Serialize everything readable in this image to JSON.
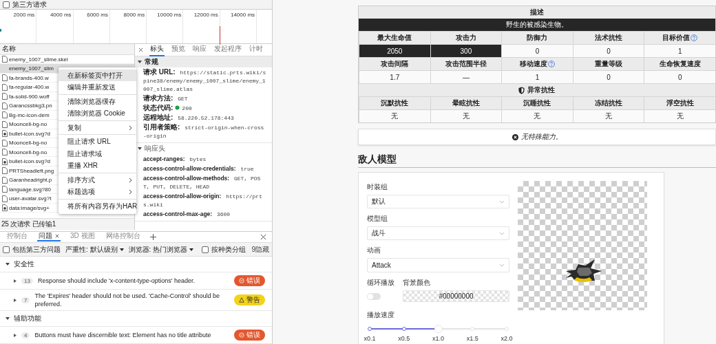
{
  "filter": {
    "label": "第三方请求",
    "checked": false
  },
  "timeline": {
    "ticks": [
      "2000 ms",
      "4000 ms",
      "6000 ms",
      "8000 ms",
      "10000 ms",
      "12000 ms",
      "14000 ms"
    ]
  },
  "requests": {
    "column": "名称",
    "items": [
      {
        "name": "enemy_1007_slime.skel",
        "kind": "document",
        "selected": false
      },
      {
        "name": "enemy_1007_slim",
        "kind": "blank",
        "selected": true
      },
      {
        "name": "fa-brands-400.w",
        "kind": "document",
        "selected": false
      },
      {
        "name": "fa-regular-400.w",
        "kind": "document",
        "selected": false
      },
      {
        "name": "fa-solid-900.woff",
        "kind": "document",
        "selected": false
      },
      {
        "name": "Garancssbkg3.pn",
        "kind": "document",
        "selected": false
      },
      {
        "name": "Bg-mc-icon-dem",
        "kind": "document",
        "selected": false
      },
      {
        "name": "Mooncell-bg-no",
        "kind": "document",
        "selected": false
      },
      {
        "name": "bullet-icon.svg?d",
        "kind": "image",
        "selected": false
      },
      {
        "name": "Mooncell-bg-no",
        "kind": "document",
        "selected": false
      },
      {
        "name": "Mooncell-bg-no",
        "kind": "document",
        "selected": false
      },
      {
        "name": "bullet-icon.svg?d",
        "kind": "image",
        "selected": false
      },
      {
        "name": "PRTSheadleft.png",
        "kind": "document",
        "selected": false
      },
      {
        "name": "Garanheadright.p",
        "kind": "document",
        "selected": false
      },
      {
        "name": "language.svg?80",
        "kind": "document",
        "selected": false
      },
      {
        "name": "user-avatar.svg?t",
        "kind": "document",
        "selected": false
      },
      {
        "name": "data:image/svg+",
        "kind": "image",
        "selected": false
      }
    ],
    "status": "25 次请求 已传输1"
  },
  "context_menu": [
    {
      "kind": "item",
      "label": "在新标签页中打开",
      "highlighted": true,
      "submenu": false
    },
    {
      "kind": "item",
      "label": "编辑并重新发送",
      "highlighted": false,
      "submenu": false
    },
    {
      "kind": "separator"
    },
    {
      "kind": "item",
      "label": "清除浏览器缓存",
      "highlighted": false,
      "submenu": false
    },
    {
      "kind": "item",
      "label": "清除浏览器 Cookie",
      "highlighted": false,
      "submenu": false
    },
    {
      "kind": "separator"
    },
    {
      "kind": "item",
      "label": "复制",
      "highlighted": false,
      "submenu": true
    },
    {
      "kind": "separator"
    },
    {
      "kind": "item",
      "label": "阻止请求 URL",
      "highlighted": false,
      "submenu": false
    },
    {
      "kind": "item",
      "label": "阻止请求域",
      "highlighted": false,
      "submenu": false
    },
    {
      "kind": "item",
      "label": "重播 XHR",
      "highlighted": false,
      "submenu": false
    },
    {
      "kind": "separator"
    },
    {
      "kind": "item",
      "label": "排序方式",
      "highlighted": false,
      "submenu": true
    },
    {
      "kind": "item",
      "label": "标题选项",
      "highlighted": false,
      "submenu": true
    },
    {
      "kind": "separator"
    },
    {
      "kind": "item",
      "label": "将所有内容另存为HAR",
      "highlighted": false,
      "submenu": false
    }
  ],
  "details": {
    "tabs": [
      {
        "label": "标头",
        "selected": true
      },
      {
        "label": "预览",
        "selected": false
      },
      {
        "label": "响应",
        "selected": false
      },
      {
        "label": "发起程序",
        "selected": false
      },
      {
        "label": "计时",
        "selected": false
      }
    ],
    "sections": [
      {
        "title": "常规",
        "expanded": true,
        "rows": [
          {
            "name": "请求 URL:",
            "value": "https://static.prts.wiki/spine38/enemy/enemy_1007_slime/enemy_1007_slime.atlas",
            "kind": "text"
          },
          {
            "name": "请求方法:",
            "value": "GET",
            "kind": "text"
          },
          {
            "name": "状态代码:",
            "value": "200",
            "kind": "status"
          },
          {
            "name": "远程地址:",
            "value": "58.220.52.178:443",
            "kind": "text"
          },
          {
            "name": "引用者策略:",
            "value": "strict-origin-when-cross-origin",
            "kind": "text"
          }
        ]
      },
      {
        "title": "响应头",
        "expanded": true,
        "rows": [
          {
            "name": "accept-ranges:",
            "value": "bytes",
            "kind": "text"
          },
          {
            "name": "access-control-allow-credentials:",
            "value": "true",
            "kind": "text"
          },
          {
            "name": "access-control-allow-methods:",
            "value": "GET, POST, PUT, DELETE, HEAD",
            "kind": "text"
          },
          {
            "name": "access-control-allow-origin:",
            "value": "https://prts.wiki",
            "kind": "text"
          },
          {
            "name": "access-control-max-age:",
            "value": "3600",
            "kind": "text"
          }
        ]
      }
    ]
  },
  "drawer": {
    "tabs": [
      {
        "label": "控制台",
        "selected": false,
        "closable": false
      },
      {
        "label": "问题",
        "selected": true,
        "closable": true
      },
      {
        "label": "3D 视图",
        "selected": false,
        "closable": false
      },
      {
        "label": "网络控制台",
        "selected": false,
        "closable": false
      }
    ]
  },
  "issues_toolbar": {
    "third_party": {
      "label": "包括第三方问题",
      "checked": false
    },
    "severity": "严重性: 默认级别",
    "browser": "浏览器:  热门浏览器",
    "group": {
      "label": "按种类分组",
      "checked": false
    },
    "hidden": "9隐藏"
  },
  "issue_groups": [
    {
      "title": "安全性",
      "expanded": true,
      "issues": [
        {
          "count": "13",
          "message": "Response should include 'x-content-type-options' header.",
          "kind": "error",
          "badge": "错误"
        },
        {
          "count": "7",
          "message": "The 'Expires' header should not be used. 'Cache-Control' should be preferred.",
          "kind": "warning",
          "badge": "警告"
        }
      ]
    },
    {
      "title": "辅助功能",
      "expanded": true,
      "issues": [
        {
          "count": "4",
          "message": "Buttons must have discernible text: Element has no title attribute",
          "kind": "error",
          "badge": "错误"
        }
      ]
    }
  ],
  "stat_rows": [
    {
      "kind": "title",
      "text": "描述"
    },
    {
      "kind": "banner",
      "text": "野生的被感染生物。"
    },
    {
      "kind": "header",
      "cells": [
        {
          "text": "最大生命值",
          "help": false
        },
        {
          "text": "攻击力",
          "help": false
        },
        {
          "text": "防御力",
          "help": false
        },
        {
          "text": "法术抗性",
          "help": false
        },
        {
          "text": "目标价值",
          "help": true
        }
      ]
    },
    {
      "kind": "values",
      "cells": [
        {
          "text": "2050",
          "highlighted": true
        },
        {
          "text": "300",
          "highlighted": true
        },
        {
          "text": "0",
          "highlighted": false
        },
        {
          "text": "0",
          "highlighted": false
        },
        {
          "text": "1",
          "highlighted": false
        }
      ]
    },
    {
      "kind": "header",
      "cells": [
        {
          "text": "攻击间隔",
          "help": false
        },
        {
          "text": "攻击范围半径",
          "help": false
        },
        {
          "text": "移动速度",
          "help": true
        },
        {
          "text": "重量等级",
          "help": false
        },
        {
          "text": "生命恢复速度",
          "help": false
        }
      ]
    },
    {
      "kind": "values",
      "cells": [
        {
          "text": "1.7",
          "highlighted": false
        },
        {
          "text": "—",
          "highlighted": false
        },
        {
          "text": "1",
          "highlighted": false
        },
        {
          "text": "0",
          "highlighted": false
        },
        {
          "text": "0",
          "highlighted": false
        }
      ]
    },
    {
      "kind": "section",
      "text": "异常抗性"
    },
    {
      "kind": "header",
      "cells": [
        {
          "text": "沉默抗性",
          "help": false
        },
        {
          "text": "晕眩抗性",
          "help": false
        },
        {
          "text": "沉睡抗性",
          "help": false
        },
        {
          "text": "冻结抗性",
          "help": false
        },
        {
          "text": "浮空抗性",
          "help": false
        }
      ]
    },
    {
      "kind": "values",
      "cells": [
        {
          "text": "无",
          "highlighted": false
        },
        {
          "text": "无",
          "highlighted": false
        },
        {
          "text": "无",
          "highlighted": false
        },
        {
          "text": "无",
          "highlighted": false
        },
        {
          "text": "无",
          "highlighted": false
        }
      ]
    }
  ],
  "ability_note": "无特殊能力。",
  "model": {
    "title": "敌人模型",
    "fields": [
      {
        "label": "时装组",
        "value": "默认"
      },
      {
        "label": "模型组",
        "value": "战斗"
      },
      {
        "label": "动画",
        "value": "Attack"
      }
    ],
    "loop": {
      "label": "循环播放",
      "on": false
    },
    "background": {
      "label": "背景颜色",
      "value": "#00000000"
    },
    "speed": {
      "label": "播放速度",
      "level": 0.5,
      "stops": [
        "x0.1",
        "x0.5",
        "x1.0",
        "x1.5",
        "x2.0"
      ]
    }
  }
}
